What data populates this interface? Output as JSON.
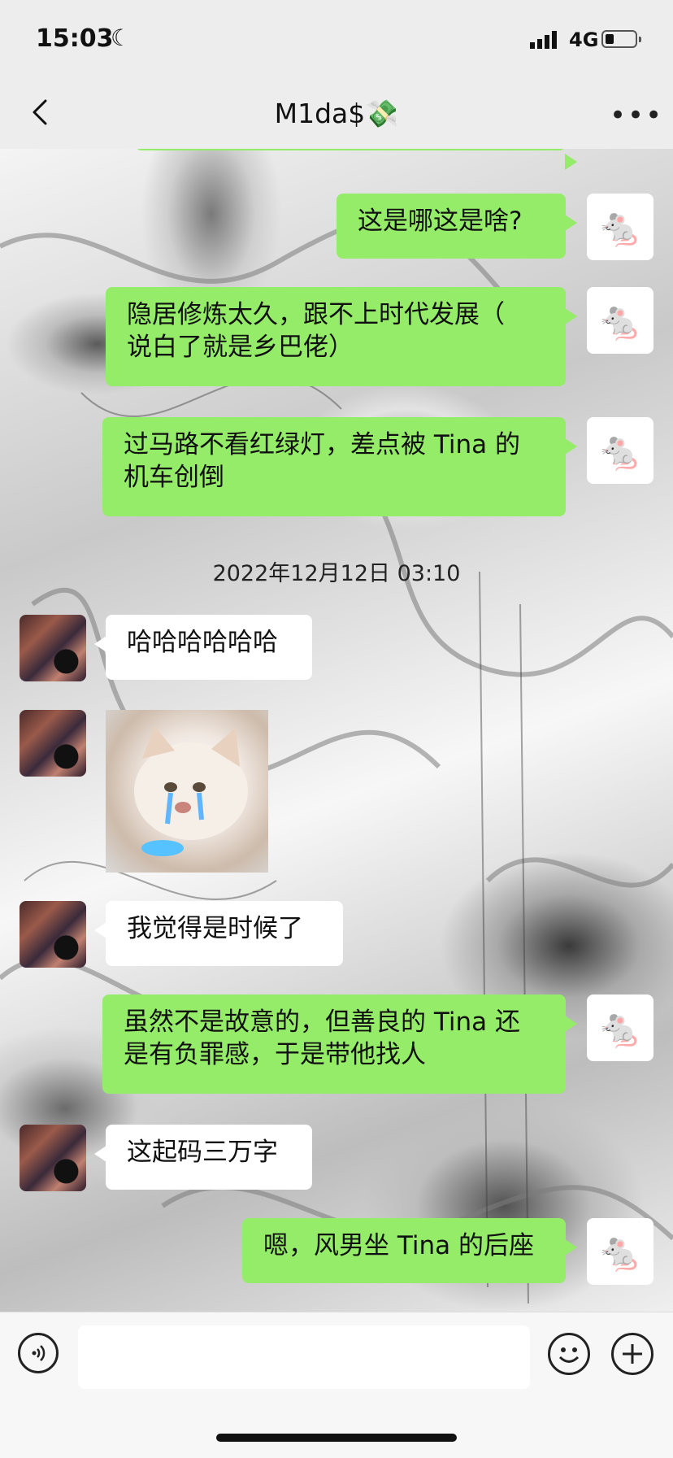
{
  "status": {
    "time": "15:03",
    "network": "4G"
  },
  "nav": {
    "title": "M1da$💸"
  },
  "timestamp": "2022年12月12日 03:10",
  "messages": {
    "m1": "这是哪这是啥?",
    "m2a": "隐居修炼太久，跟不上时代发展（",
    "m2b": "说白了就是乡巴佬）",
    "m3a": "过马路不看红绿灯，差点被 Tina 的",
    "m3b": "机车创倒",
    "m4": "哈哈哈哈哈哈",
    "m5": "我觉得是时候了",
    "m6a": "虽然不是故意的，但善良的 Tina 还",
    "m6b": "是有负罪感，于是带他找人",
    "m7": "这起码三万字",
    "m8": "嗯，风男坐 Tina 的后座"
  },
  "icons": {
    "me_avatar": "🐁",
    "moon": "☾"
  },
  "colors": {
    "me_bubble": "#95ec69",
    "other_bubble": "#ffffff"
  }
}
